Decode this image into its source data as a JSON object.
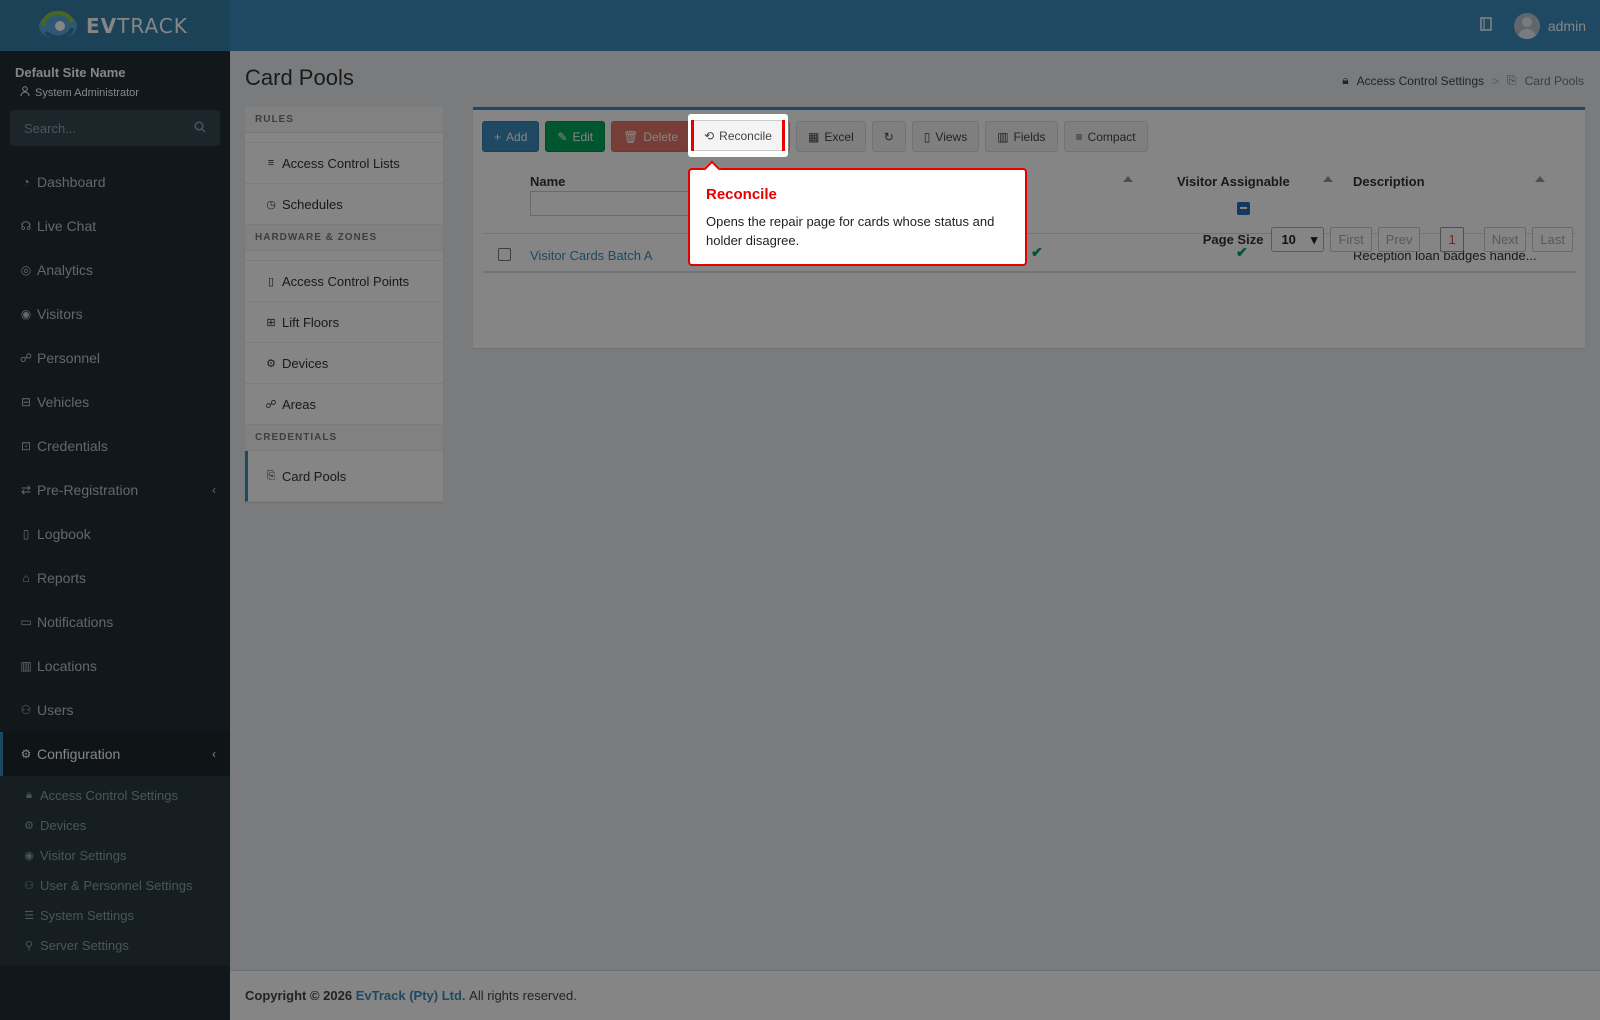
{
  "topbar": {
    "brand_prefix": "EV",
    "brand_suffix": "TRACK",
    "user_name": "admin"
  },
  "sidebar": {
    "site_name": "Default Site Name",
    "site_role": "System Administrator",
    "search_placeholder": "Search...",
    "items": [
      {
        "label": "Dashboard",
        "icon": "dashboard-icon"
      },
      {
        "label": "Live Chat",
        "icon": "headset-icon"
      },
      {
        "label": "Analytics",
        "icon": "target-icon"
      },
      {
        "label": "Visitors",
        "icon": "eye-icon"
      },
      {
        "label": "Personnel",
        "icon": "users-icon"
      },
      {
        "label": "Vehicles",
        "icon": "car-icon"
      },
      {
        "label": "Credentials",
        "icon": "id-card-icon"
      },
      {
        "label": "Pre-Registration",
        "icon": "arrows-icon"
      },
      {
        "label": "Logbook",
        "icon": "book-icon"
      },
      {
        "label": "Reports",
        "icon": "chart-icon"
      },
      {
        "label": "Notifications",
        "icon": "message-icon"
      },
      {
        "label": "Locations",
        "icon": "map-icon"
      },
      {
        "label": "Users",
        "icon": "user-cog-icon"
      },
      {
        "label": "Configuration",
        "icon": "gear-icon"
      }
    ],
    "subitems": [
      {
        "label": "Access Control Settings",
        "icon": "lock-icon"
      },
      {
        "label": "Devices",
        "icon": "cog-icon"
      },
      {
        "label": "Visitor Settings",
        "icon": "eye-icon"
      },
      {
        "label": "User & Personnel Settings",
        "icon": "user-cog-icon"
      },
      {
        "label": "System Settings",
        "icon": "sliders-icon"
      },
      {
        "label": "Server Settings",
        "icon": "server-icon"
      }
    ]
  },
  "page": {
    "title": "Card Pools",
    "breadcrumb": [
      "Access Control Settings",
      "Card Pools"
    ],
    "breadcrumb_sep": ">"
  },
  "settings_menu": {
    "rules_header": "RULES",
    "rules": [
      "Access Control Lists",
      "Schedules"
    ],
    "hardware_header": "HARDWARE & ZONES",
    "hardware": [
      "Access Control Points",
      "Lift Floors",
      "Devices",
      "Areas"
    ],
    "credentials_header": "CREDENTIALS",
    "credentials": [
      "Card Pools"
    ]
  },
  "toolbar": {
    "add": "Add",
    "edit": "Edit",
    "delete": "Delete",
    "reconcile": "Reconcile",
    "excel": "Excel",
    "views": "Views",
    "fields": "Fields",
    "compact": "Compact"
  },
  "grid": {
    "columns": [
      "Name",
      "Visitor Assignable",
      "Description"
    ],
    "rows": [
      {
        "name": "Visitor Cards Batch A",
        "description": "Reception loan badges hande..."
      }
    ]
  },
  "pager": {
    "label": "Page Size",
    "size": "10",
    "first": "First",
    "prev": "Prev",
    "current": "1",
    "next": "Next",
    "last": "Last"
  },
  "footer": {
    "copyright": "Copyright © 2026",
    "company": "EvTrack (Pty) Ltd.",
    "rights": "All rights reserved."
  },
  "tooltip": {
    "title": "Reconcile",
    "body": "Opens the repair page for cards whose status and holder disagree."
  },
  "colors": {
    "accent": "#3c8dbc",
    "highlight": "#e60000",
    "success": "#00a65a",
    "danger": "#dd4b39"
  }
}
